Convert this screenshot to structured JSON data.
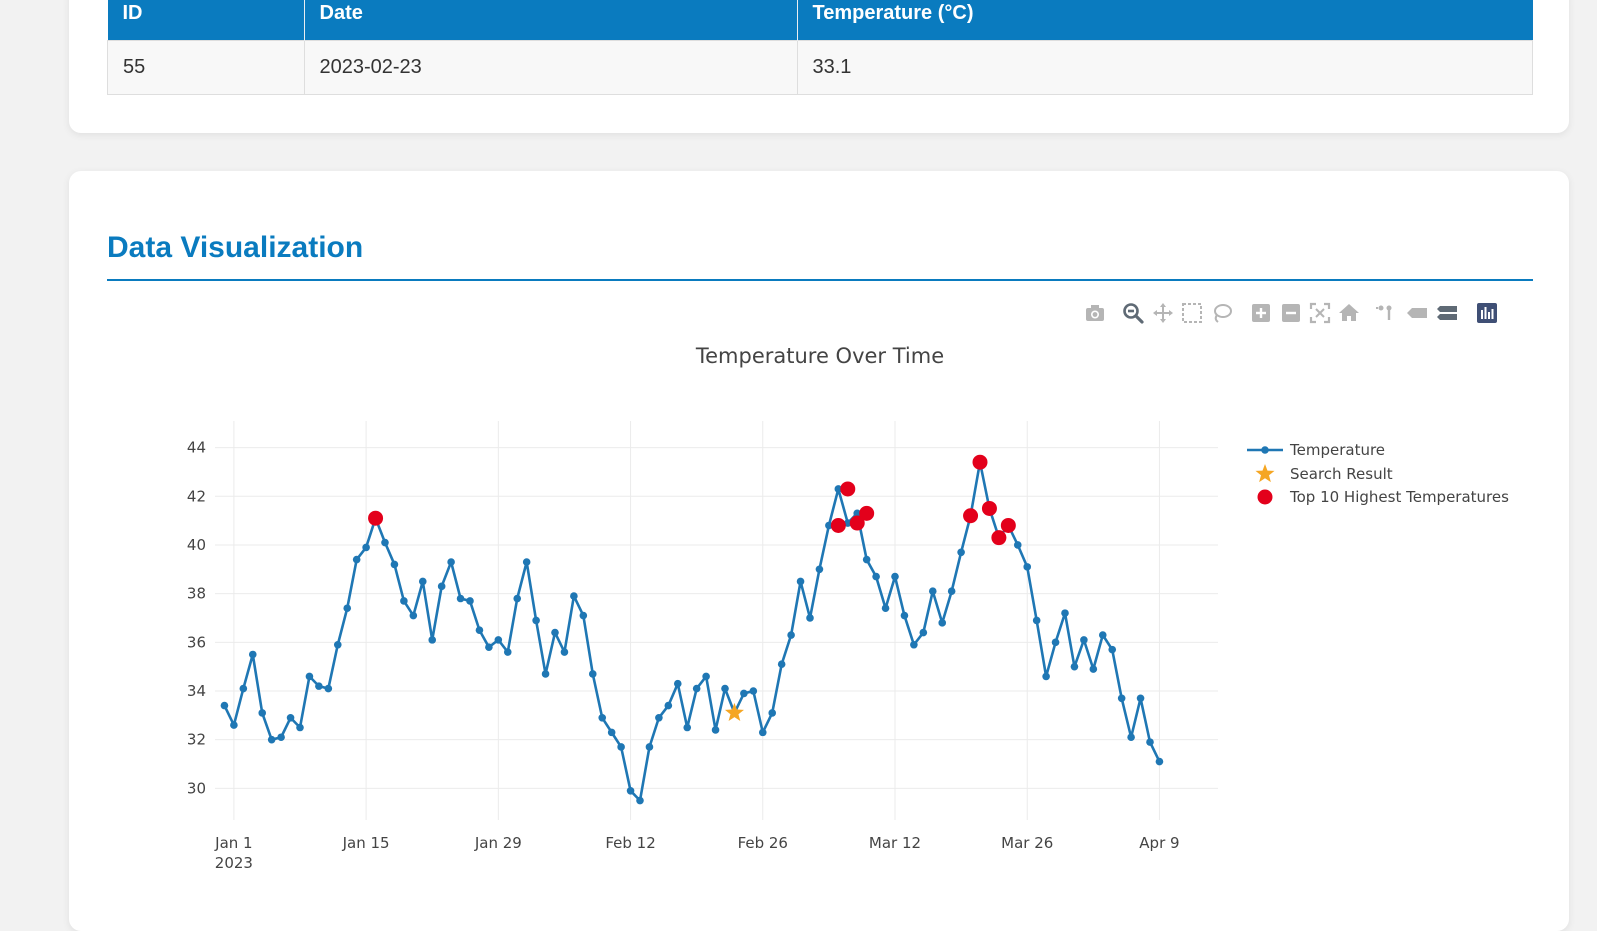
{
  "results_table": {
    "headers": [
      "ID",
      "Date",
      "Temperature (°C)"
    ],
    "rows": [
      [
        "55",
        "2023-02-23",
        "33.1"
      ]
    ]
  },
  "section_title": "Data Visualization",
  "modebar_icons": [
    "camera-icon",
    "zoom-icon",
    "pan-icon",
    "box-select-icon",
    "lasso-select-icon",
    "zoom-in-icon",
    "zoom-out-icon",
    "autoscale-icon",
    "reset-axes-icon",
    "spike-lines-icon",
    "hover-closest-icon",
    "hover-compare-icon",
    "plotly-logo-icon"
  ],
  "chart_data": {
    "type": "line",
    "title": "Temperature Over Time",
    "xlabel": "",
    "ylabel": "",
    "x_start": "2022-12-31",
    "x_ticks": [
      "Jan 1\n2023",
      "Jan 15",
      "Jan 29",
      "Feb 12",
      "Feb 26",
      "Mar 12",
      "Mar 26",
      "Apr 9"
    ],
    "x_tick_dates": [
      "2023-01-01",
      "2023-01-15",
      "2023-01-29",
      "2023-02-12",
      "2023-02-26",
      "2023-03-12",
      "2023-03-26",
      "2023-04-09"
    ],
    "ylim": [
      28.7,
      44.6
    ],
    "y_ticks": [
      30,
      32,
      34,
      36,
      38,
      40,
      42,
      44
    ],
    "grid": true,
    "legend_position": "top-right",
    "series": [
      {
        "name": "Temperature",
        "color": "#1f77b4",
        "values": [
          33.4,
          32.6,
          34.1,
          35.5,
          33.1,
          32.0,
          32.1,
          32.9,
          32.5,
          34.6,
          34.2,
          34.1,
          35.9,
          37.4,
          39.4,
          39.9,
          41.1,
          40.1,
          39.2,
          37.7,
          37.1,
          38.5,
          36.1,
          38.3,
          39.3,
          37.8,
          37.7,
          36.5,
          35.8,
          36.1,
          35.6,
          37.8,
          39.3,
          36.9,
          34.7,
          36.4,
          35.6,
          37.9,
          37.1,
          34.7,
          32.9,
          32.3,
          31.7,
          29.9,
          29.5,
          31.7,
          32.9,
          33.4,
          34.3,
          32.5,
          34.1,
          34.6,
          32.4,
          34.1,
          33.1,
          33.9,
          34.0,
          32.3,
          33.1,
          35.1,
          36.3,
          38.5,
          37.0,
          39.0,
          40.8,
          42.3,
          40.9,
          41.3,
          39.4,
          38.7,
          37.4,
          38.7,
          37.1,
          35.9,
          36.4,
          38.1,
          36.8,
          38.1,
          39.7,
          41.2,
          43.4,
          41.5,
          40.3,
          40.8,
          40.0,
          39.1,
          36.9,
          34.6,
          36.0,
          37.2,
          35.0,
          36.1,
          34.9,
          36.3,
          35.7,
          33.7,
          32.1,
          33.7,
          31.9,
          31.1
        ]
      },
      {
        "name": "Search Result",
        "color": "#f5a623",
        "points": [
          {
            "x": "2023-02-23",
            "y": 33.1
          }
        ]
      },
      {
        "name": "Top 10 Highest Temperatures",
        "color": "#e3001b",
        "points": [
          {
            "x": "2023-01-16",
            "y": 41.1
          },
          {
            "x": "2023-03-06",
            "y": 40.8
          },
          {
            "x": "2023-03-07",
            "y": 42.3
          },
          {
            "x": "2023-03-08",
            "y": 40.9
          },
          {
            "x": "2023-03-09",
            "y": 41.3
          },
          {
            "x": "2023-03-20",
            "y": 41.2
          },
          {
            "x": "2023-03-21",
            "y": 43.4
          },
          {
            "x": "2023-03-22",
            "y": 41.5
          },
          {
            "x": "2023-03-23",
            "y": 40.3
          },
          {
            "x": "2023-03-24",
            "y": 40.8
          }
        ]
      }
    ]
  }
}
